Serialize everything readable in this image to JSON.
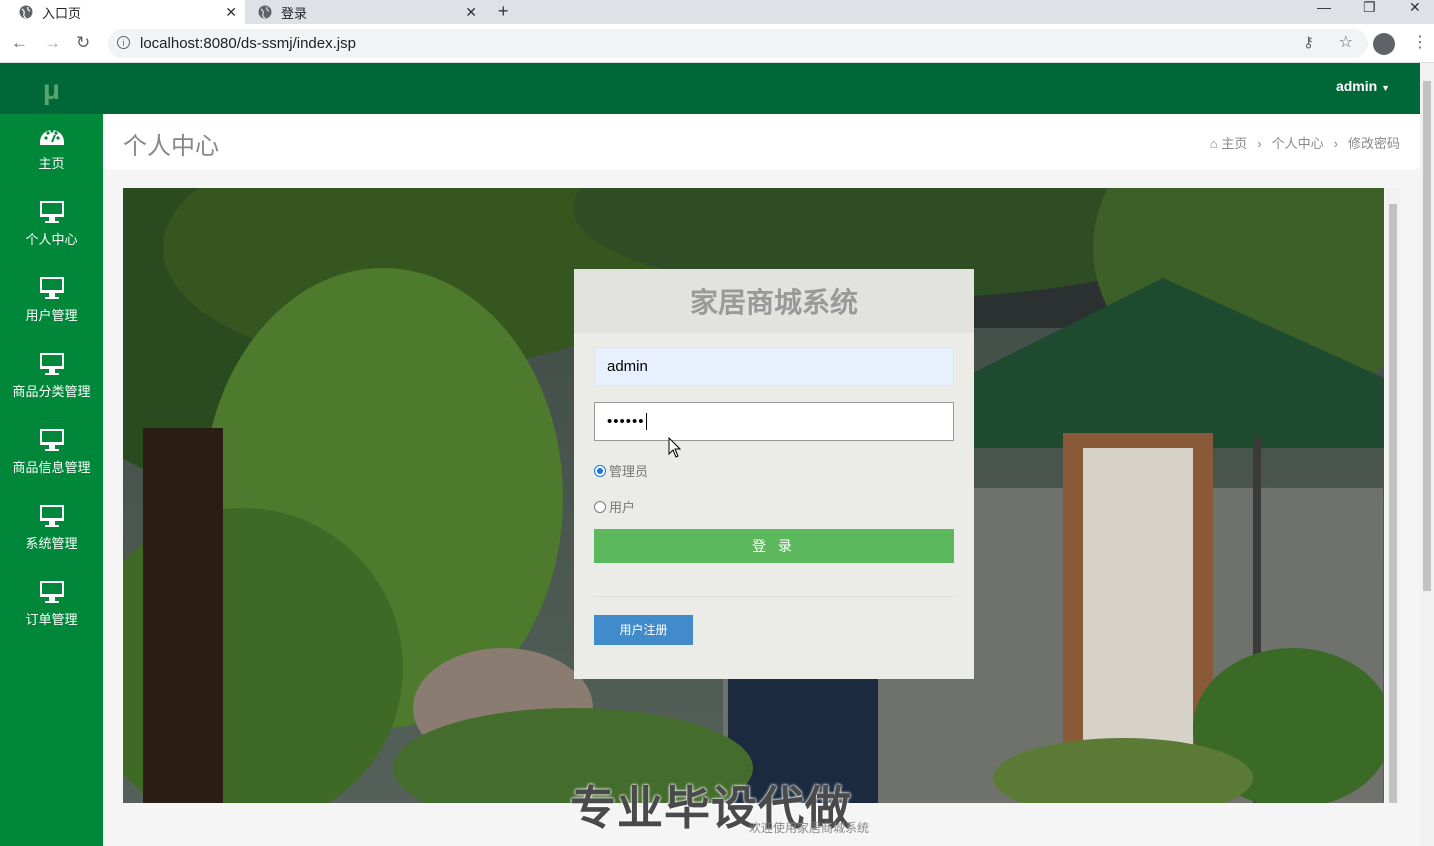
{
  "browser": {
    "tabs": [
      {
        "title": "入口页",
        "active": true
      },
      {
        "title": "登录",
        "active": false
      }
    ],
    "url": "localhost:8080/ds-ssmj/index.jsp"
  },
  "sidebar": {
    "logo": "μ",
    "items": [
      {
        "label": "主页",
        "icon": "dashboard-icon"
      },
      {
        "label": "个人中心",
        "icon": "monitor-icon"
      },
      {
        "label": "用户管理",
        "icon": "monitor-icon"
      },
      {
        "label": "商品分类管理",
        "icon": "monitor-icon"
      },
      {
        "label": "商品信息管理",
        "icon": "monitor-icon"
      },
      {
        "label": "系统管理",
        "icon": "monitor-icon"
      },
      {
        "label": "订单管理",
        "icon": "monitor-icon"
      }
    ]
  },
  "topnav": {
    "user": "admin"
  },
  "page": {
    "title": "个人中心",
    "breadcrumb": [
      "主页",
      "个人中心",
      "修改密码"
    ]
  },
  "login": {
    "title": "家居商城系统",
    "username": "admin",
    "password_mask": "••••••",
    "roles": [
      {
        "label": "管理员",
        "checked": true
      },
      {
        "label": "用户",
        "checked": false
      }
    ],
    "login_button": "登 录",
    "register_button": "用户注册"
  },
  "watermark": "专业毕设代做",
  "footer": "欢迎使用家居商城系统",
  "colors": {
    "sidebar": "#00873a",
    "topnav": "#006838",
    "login_button": "#5cb85c",
    "register_button": "#428bca"
  }
}
